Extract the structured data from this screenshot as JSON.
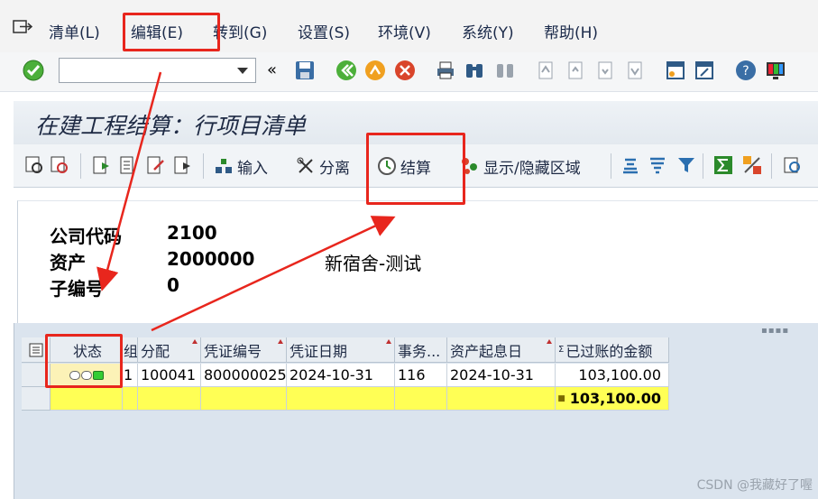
{
  "menu": {
    "items": [
      {
        "label": "清单(L)"
      },
      {
        "label": "编辑(E)"
      },
      {
        "label": "转到(G)"
      },
      {
        "label": "设置(S)"
      },
      {
        "label": "环境(V)"
      },
      {
        "label": "系统(Y)"
      },
      {
        "label": "帮助(H)"
      }
    ]
  },
  "command_field": {
    "value": "",
    "placeholder": ""
  },
  "title": "在建工程结算：行项目清单",
  "app_toolbar": {
    "input_label": "输入",
    "split_label": "分离",
    "settle_label": "结算",
    "show_hide_label": "显示/隐藏区域"
  },
  "header": {
    "company_code_label": "公司代码",
    "company_code_value": "2100",
    "asset_label": "资产",
    "asset_value": "2000000",
    "asset_desc": "新宿舍-测试",
    "subnumber_label": "子编号",
    "subnumber_value": "0"
  },
  "grid": {
    "columns": [
      "状态",
      "组",
      "分配",
      "凭证编号",
      "凭证日期",
      "事务...",
      "资产起息日",
      "已过账的金额"
    ],
    "rows": [
      [
        "",
        "1",
        "100041",
        "800000025",
        "2024-10-31",
        "116",
        "2024-10-31",
        "103,100.00"
      ]
    ],
    "total": "103,100.00",
    "total_marker": "■"
  },
  "watermark": "CSDN @我藏好了喔",
  "colors": {
    "annotation": "#e8261d",
    "total_row": "#ffff55"
  }
}
